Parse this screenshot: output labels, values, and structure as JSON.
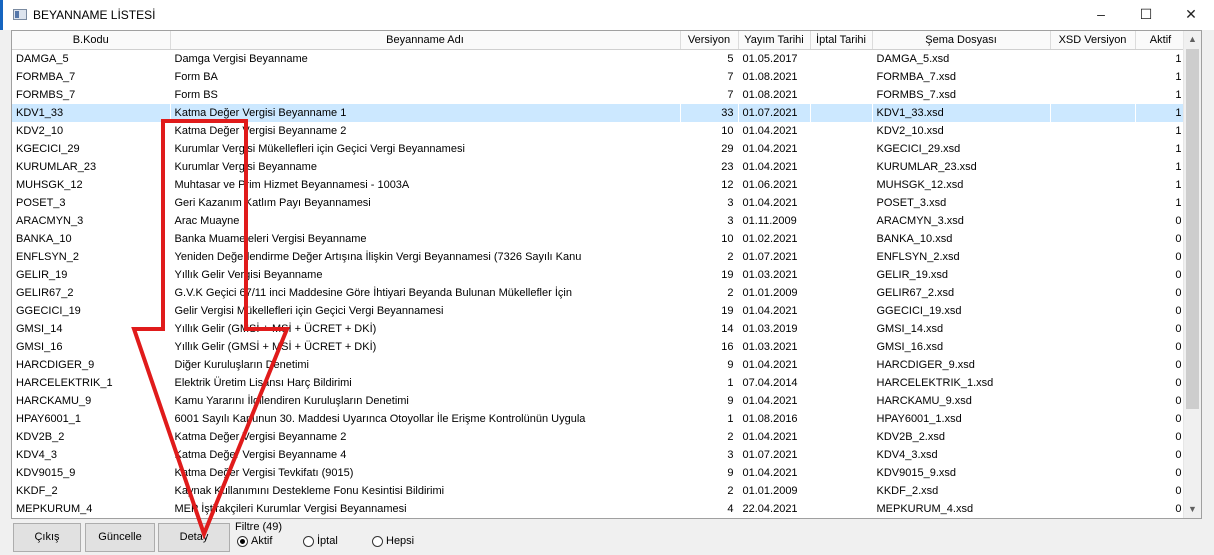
{
  "window": {
    "title": "BEYANNAME LİSTESİ",
    "minimize": "–",
    "maximize": "☐",
    "close": "✕"
  },
  "columns": [
    "B.Kodu",
    "Beyanname Adı",
    "Versiyon",
    "Yayım Tarihi",
    "İptal Tarihi",
    "Şema Dosyası",
    "XSD Versiyon",
    "Aktif"
  ],
  "rows": [
    [
      "DAMGA_5",
      "Damga Vergisi Beyanname",
      "5",
      "01.05.2017",
      "",
      "DAMGA_5.xsd",
      "",
      "1"
    ],
    [
      "FORMBA_7",
      "Form BA",
      "7",
      "01.08.2021",
      "",
      "FORMBA_7.xsd",
      "",
      "1"
    ],
    [
      "FORMBS_7",
      "Form BS",
      "7",
      "01.08.2021",
      "",
      "FORMBS_7.xsd",
      "",
      "1"
    ],
    [
      "KDV1_33",
      "Katma Değer Vergisi Beyanname 1",
      "33",
      "01.07.2021",
      "",
      "KDV1_33.xsd",
      "",
      "1"
    ],
    [
      "KDV2_10",
      "Katma Değer Vergisi Beyanname 2",
      "10",
      "01.04.2021",
      "",
      "KDV2_10.xsd",
      "",
      "1"
    ],
    [
      "KGECICI_29",
      "Kurumlar Vergisi Mükellefleri için Geçici Vergi Beyannamesi",
      "29",
      "01.04.2021",
      "",
      "KGECICI_29.xsd",
      "",
      "1"
    ],
    [
      "KURUMLAR_23",
      "Kurumlar Vergisi Beyanname",
      "23",
      "01.04.2021",
      "",
      "KURUMLAR_23.xsd",
      "",
      "1"
    ],
    [
      "MUHSGK_12",
      "Muhtasar ve Prim Hizmet Beyannamesi - 1003A",
      "12",
      "01.06.2021",
      "",
      "MUHSGK_12.xsd",
      "",
      "1"
    ],
    [
      "POSET_3",
      "Geri Kazanım Katlım Payı Beyannamesi",
      "3",
      "01.04.2021",
      "",
      "POSET_3.xsd",
      "",
      "1"
    ],
    [
      "ARACMYN_3",
      "Arac Muayne",
      "3",
      "01.11.2009",
      "",
      "ARACMYN_3.xsd",
      "",
      "0"
    ],
    [
      "BANKA_10",
      "Banka Muameleleri Vergisi Beyanname",
      "10",
      "01.02.2021",
      "",
      "BANKA_10.xsd",
      "",
      "0"
    ],
    [
      "ENFLSYN_2",
      "Yeniden Değerlendirme Değer Artışına İlişkin Vergi Beyannamesi (7326 Sayılı Kanu",
      "2",
      "01.07.2021",
      "",
      "ENFLSYN_2.xsd",
      "",
      "0"
    ],
    [
      "GELIR_19",
      "Yıllık Gelir Vergisi Beyanname",
      "19",
      "01.03.2021",
      "",
      "GELIR_19.xsd",
      "",
      "0"
    ],
    [
      "GELIR67_2",
      "G.V.K Geçici 67/11 inci Maddesine Göre İhtiyari Beyanda Bulunan Mükellefler İçin",
      "2",
      "01.01.2009",
      "",
      "GELIR67_2.xsd",
      "",
      "0"
    ],
    [
      "GGECICI_19",
      "Gelir Vergisi Mükellefleri için Geçici Vergi Beyannamesi",
      "19",
      "01.04.2021",
      "",
      "GGECICI_19.xsd",
      "",
      "0"
    ],
    [
      "GMSI_14",
      "Yıllık Gelir (GMSİ + MSİ + ÜCRET + DKİ)",
      "14",
      "01.03.2019",
      "",
      "GMSI_14.xsd",
      "",
      "0"
    ],
    [
      "GMSI_16",
      "Yıllık Gelir (GMSİ + MSİ + ÜCRET + DKİ)",
      "16",
      "01.03.2021",
      "",
      "GMSI_16.xsd",
      "",
      "0"
    ],
    [
      "HARCDIGER_9",
      "Diğer Kuruluşların Denetimi",
      "9",
      "01.04.2021",
      "",
      "HARCDIGER_9.xsd",
      "",
      "0"
    ],
    [
      "HARCELEKTRIK_1",
      "Elektrik Üretim Lisansı Harç Bildirimi",
      "1",
      "07.04.2014",
      "",
      "HARCELEKTRIK_1.xsd",
      "",
      "0"
    ],
    [
      "HARCKAMU_9",
      "Kamu Yararını İlgilendiren Kuruluşların Denetimi",
      "9",
      "01.04.2021",
      "",
      "HARCKAMU_9.xsd",
      "",
      "0"
    ],
    [
      "HPAY6001_1",
      "6001 Sayılı Kanunun 30. Maddesi Uyarınca Otoyollar İle Erişme Kontrolünün Uygula",
      "1",
      "01.08.2016",
      "",
      "HPAY6001_1.xsd",
      "",
      "0"
    ],
    [
      "KDV2B_2",
      "Katma Değer Vergisi Beyanname 2",
      "2",
      "01.04.2021",
      "",
      "KDV2B_2.xsd",
      "",
      "0"
    ],
    [
      "KDV4_3",
      "Katma Değer Vergisi Beyanname 4",
      "3",
      "01.07.2021",
      "",
      "KDV4_3.xsd",
      "",
      "0"
    ],
    [
      "KDV9015_9",
      "Katma Değer Vergisi Tevkifatı (9015)",
      "9",
      "01.04.2021",
      "",
      "KDV9015_9.xsd",
      "",
      "0"
    ],
    [
      "KKDF_2",
      "Kaynak Kullanımını Destekleme Fonu Kesintisi Bildirimi",
      "2",
      "01.01.2009",
      "",
      "KKDF_2.xsd",
      "",
      "0"
    ],
    [
      "MEPKURUM_4",
      "MEP İştirakçileri Kurumlar Vergisi Beyannamesi",
      "4",
      "22.04.2021",
      "",
      "MEPKURUM_4.xsd",
      "",
      "0"
    ]
  ],
  "selected_row": 3,
  "buttons": {
    "exit": "Çıkış",
    "update": "Güncelle",
    "detail": "Detay"
  },
  "filter": {
    "label": "Filtre (49)",
    "options": [
      {
        "label": "Aktif",
        "checked": true
      },
      {
        "label": "İptal",
        "checked": false
      },
      {
        "label": "Hepsi",
        "checked": false
      }
    ]
  },
  "colors": {
    "selection": "#cce8ff",
    "annotation": "#e01b1b",
    "title_accent": "#1565c0"
  },
  "icons": {
    "app": "window-list-icon",
    "scroll_up": "scroll-up-arrow-icon",
    "scroll_down": "scroll-down-arrow-icon"
  }
}
